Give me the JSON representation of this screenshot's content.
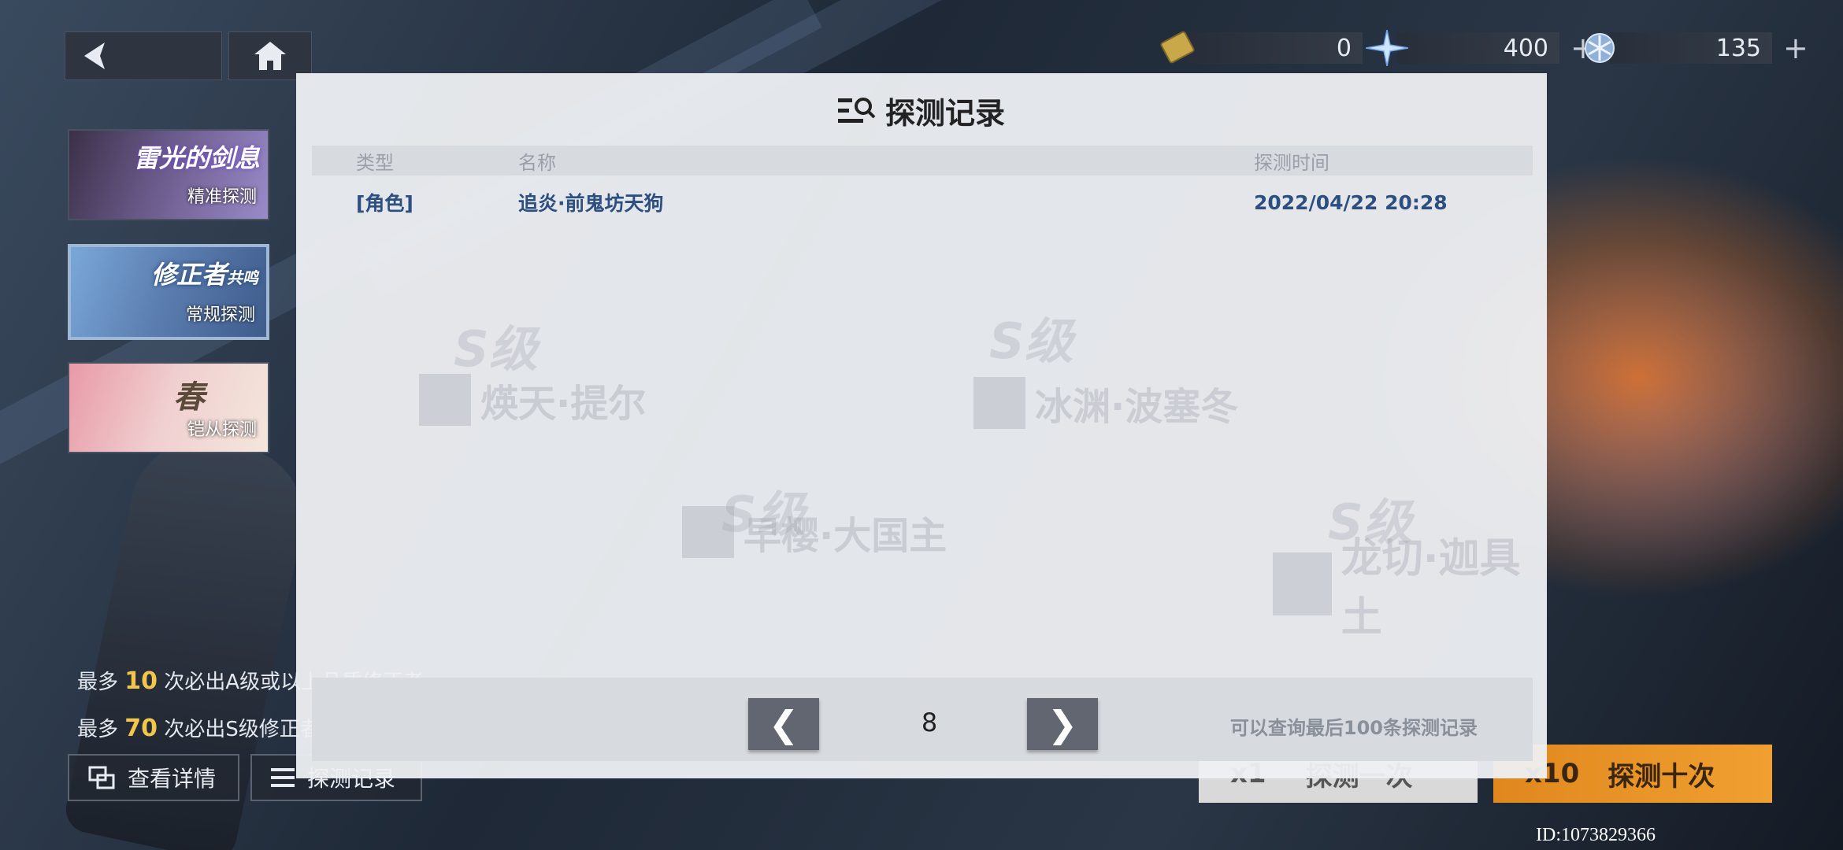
{
  "currency": [
    {
      "icon": "ticket-icon",
      "value": "0",
      "has_plus": false
    },
    {
      "icon": "crystal-icon",
      "value": "400",
      "has_plus": true
    },
    {
      "icon": "snowflake-icon",
      "value": "135",
      "has_plus": true
    }
  ],
  "banners": [
    {
      "title": "雷光的剑息",
      "sub": "精准探测"
    },
    {
      "title": "修正者",
      "title_tag": "共鸣",
      "sub": "常规探测"
    },
    {
      "title": "春",
      "sub": "铠从探测"
    }
  ],
  "guarantees": [
    {
      "prefix": "最多",
      "num": "10",
      "suffix": "次必出A级或以上品质修正者"
    },
    {
      "prefix": "最多",
      "num": "70",
      "suffix": "次必出S级修正者"
    }
  ],
  "buttons": {
    "details": "查看详情",
    "records": "探测记录",
    "draw1_count": "x1",
    "draw1_label": "探测一次",
    "draw10_count": "x10",
    "draw10_label": "探测十次"
  },
  "uid": "ID:1073829366",
  "modal": {
    "title": "探测记录",
    "columns": {
      "type": "类型",
      "name": "名称",
      "time": "探测时间"
    },
    "rows": [
      {
        "type": "[角色]",
        "name": "追炎·前鬼坊天狗",
        "time": "2022/04/22 20:28"
      }
    ],
    "page": "8",
    "prev": "❮",
    "next": "❯",
    "note": "可以查询最后100条探测记录"
  },
  "watermarks": [
    "煐天·提尔",
    "冰渊·波塞冬",
    "早樱·大国主",
    "龙切·迦具土"
  ],
  "watermark_level": "S级"
}
